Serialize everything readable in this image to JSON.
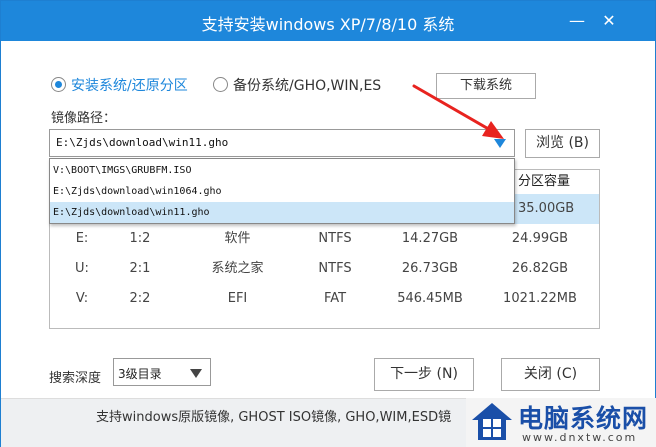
{
  "window": {
    "title": "支持安装windows XP/7/8/10 系统",
    "minimize_glyph": "—",
    "close_glyph": "✕"
  },
  "mode": {
    "install_restore": "安装系统/还原分区",
    "backup": "备份系统/GHO,WIN,ES",
    "selected": "install_restore",
    "download_button": "下载系统"
  },
  "image_path": {
    "label": "镜像路径：",
    "value": "E:\\Zjds\\download\\win11.gho",
    "browse_button": "浏览 (B)",
    "options": [
      "V:\\BOOT\\IMGS\\GRUBFM.ISO",
      "E:\\Zjds\\download\\win1064.gho",
      "E:\\Zjds\\download\\win11.gho"
    ],
    "highlighted_option": 2
  },
  "partition_table": {
    "visible_header": "分区容量",
    "rows": [
      {
        "drive": "",
        "index": "",
        "label": "",
        "fs": "",
        "free": "",
        "capacity": "35.00GB",
        "selected": true
      },
      {
        "drive": "E:",
        "index": "1:2",
        "label": "软件",
        "fs": "NTFS",
        "free": "14.27GB",
        "capacity": "24.99GB"
      },
      {
        "drive": "U:",
        "index": "2:1",
        "label": "系统之家",
        "fs": "NTFS",
        "free": "26.73GB",
        "capacity": "26.82GB"
      },
      {
        "drive": "V:",
        "index": "2:2",
        "label": "EFI",
        "fs": "FAT",
        "free": "546.45MB",
        "capacity": "1021.22MB"
      }
    ]
  },
  "search_depth": {
    "label": "搜索深度",
    "value": "3级目录"
  },
  "actions": {
    "next": "下一步 (N)",
    "close": "关闭 (C)"
  },
  "footer": {
    "text": "支持windows原版镜像, GHOST ISO镜像, GHO,WIM,ESD镜"
  },
  "watermark": {
    "text": "电脑系统网",
    "url": "www.dnxtw.com"
  },
  "colors": {
    "accent": "#1e87db",
    "selection": "#cce6f8",
    "arrow": "#e8231f",
    "brand": "#1a4fa8"
  }
}
